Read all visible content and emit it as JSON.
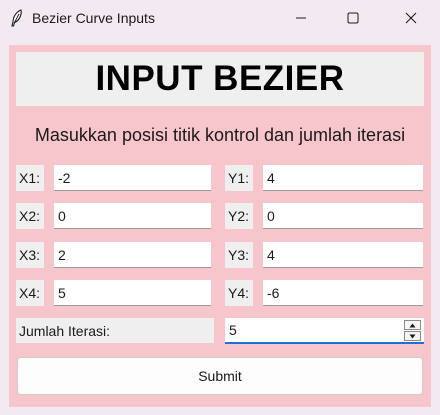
{
  "window": {
    "title": "Bezier Curve Inputs",
    "icons": {
      "app": "feather-icon",
      "minimize": "minimize-icon",
      "maximize": "maximize-icon",
      "close": "close-icon"
    }
  },
  "colors": {
    "background": "#f7c6cd",
    "label_bg": "#efefef",
    "focus_accent": "#1f6fd6"
  },
  "header": {
    "title": "INPUT BEZIER"
  },
  "subtitle": "Masukkan posisi titik kontrol dan jumlah iterasi",
  "points": [
    {
      "x_label": "X1:",
      "x_value": "-2",
      "y_label": "Y1:",
      "y_value": "4"
    },
    {
      "x_label": "X2:",
      "x_value": "0",
      "y_label": "Y2:",
      "y_value": "0"
    },
    {
      "x_label": "X3:",
      "x_value": "2",
      "y_label": "Y3:",
      "y_value": "4"
    },
    {
      "x_label": "X4:",
      "x_value": "5",
      "y_label": "Y4:",
      "y_value": "-6"
    }
  ],
  "iterations": {
    "label": "Jumlah Iterasi:",
    "value": "5"
  },
  "submit": {
    "label": "Submit"
  }
}
